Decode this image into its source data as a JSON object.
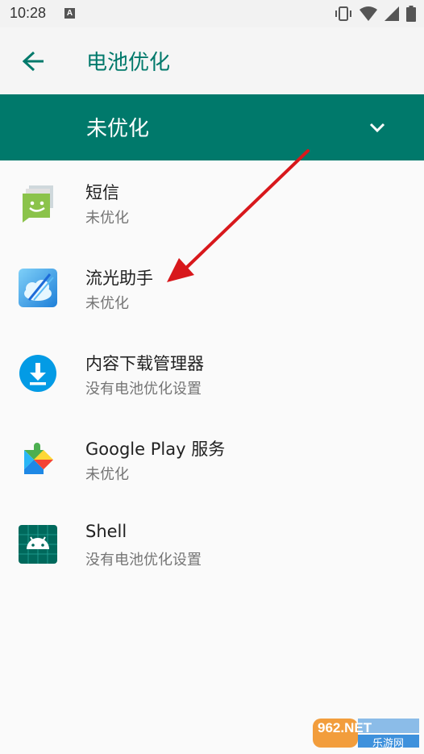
{
  "status_bar": {
    "time": "10:28",
    "notification_icon": "a-icon"
  },
  "app_bar": {
    "back_icon": "arrow-left-icon",
    "title": "电池优化"
  },
  "filter": {
    "selected": "未优化",
    "chevron_icon": "chevron-down-icon"
  },
  "apps": [
    {
      "name": "短信",
      "status": "未优化",
      "icon": "messages-icon"
    },
    {
      "name": "流光助手",
      "status": "未优化",
      "icon": "liuguang-icon"
    },
    {
      "name": "内容下载管理器",
      "status": "没有电池优化设置",
      "icon": "download-manager-icon"
    },
    {
      "name": "Google Play 服务",
      "status": "未优化",
      "icon": "google-play-services-icon"
    },
    {
      "name": "Shell",
      "status": "没有电池优化设置",
      "icon": "android-shell-icon"
    }
  ],
  "colors": {
    "accent": "#00796b",
    "annotation_arrow": "#d8181c"
  },
  "watermark": {
    "brand": "962.NET",
    "sub": "乐游网"
  }
}
